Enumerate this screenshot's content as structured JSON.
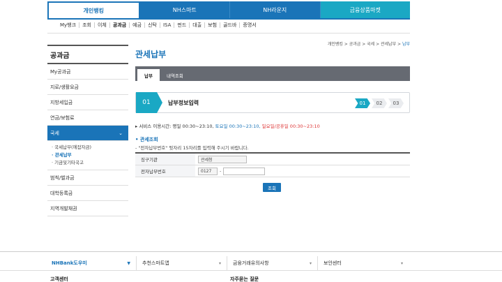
{
  "top_tabs": {
    "personal": "개인뱅킹",
    "smart": "NH스마트",
    "lounge": "NH라운지",
    "products": "금융상품마켓"
  },
  "sub_menu": [
    "My뱅크",
    "조회",
    "이체",
    "공과금",
    "예금",
    "신탁",
    "ISA",
    "펀드",
    "대출",
    "보험",
    "골드바",
    "증명서"
  ],
  "sidebar": {
    "title": "공과금",
    "items": [
      "My공과금",
      "지로/생활요금",
      "지방세입금",
      "연금/보험료",
      "국세"
    ],
    "sub_items": [
      "· 국세납부(에잡자금)",
      "· 관세납부",
      "· 기금및기타국고"
    ],
    "items_after": [
      "범칙/벌과금",
      "대학등록금",
      "지역개발채권"
    ]
  },
  "breadcrumb": {
    "path": "개인뱅킹 > 공과금 > 국세 > 관세납부 > ",
    "current": "납부"
  },
  "page_title": "관세납부",
  "content_tabs": [
    "납부",
    "내역조회"
  ],
  "step": {
    "number": "01",
    "label": "납부정보입력",
    "chain": [
      "01",
      "02",
      "03"
    ]
  },
  "service_time": {
    "prefix": "서비스 이용시간: ",
    "weekday": "평일 00:30~23:10, ",
    "saturday": "토요일 00:30~23:10, ",
    "holiday": "일요일/공휴일 00:30~23:10"
  },
  "section_title": "관세조회",
  "note": "- \"전자납부번호\" 뒷자리 15자리를 입력해 주시기 바랍니다.",
  "form": {
    "agency_label": "징구기관",
    "agency_value": "관세청",
    "number_label": "전자납부번호",
    "number_prefix": "0127",
    "dash": "-",
    "number_value": ""
  },
  "search_button": "조회",
  "footer": {
    "cells": [
      "NHBank도우미",
      "추천스마트앱",
      "금융거래유의사항",
      "보안센터"
    ],
    "bottom_left": "고객센터",
    "bottom_mid": "자주묻는 질문"
  }
}
